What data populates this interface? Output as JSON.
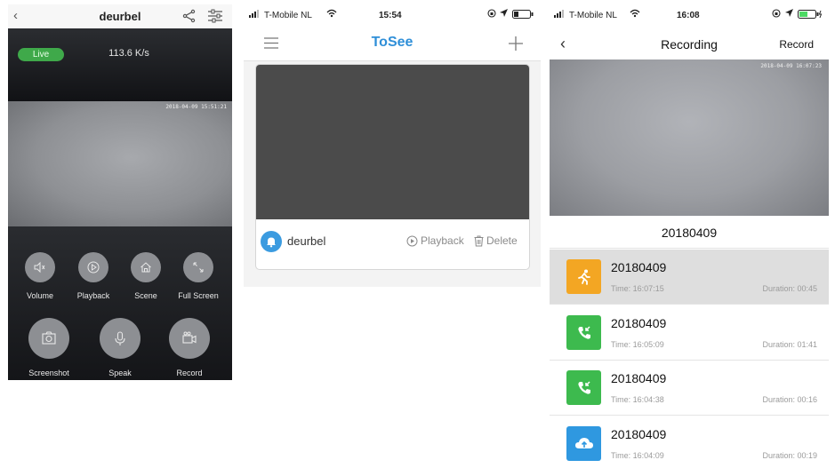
{
  "screen1": {
    "title": "deurbel",
    "live_label": "Live",
    "speed": "113.6 K/s",
    "video_timestamp": "2018-04-09 15:51:21",
    "controls": [
      {
        "label": "Volume",
        "icon": "speaker-icon"
      },
      {
        "label": "Playback",
        "icon": "play-icon"
      },
      {
        "label": "Scene",
        "icon": "home-icon"
      },
      {
        "label": "Full Screen",
        "icon": "expand-icon"
      },
      {
        "label": "Screenshot",
        "icon": "camera-icon"
      },
      {
        "label": "Speak",
        "icon": "microphone-icon"
      },
      {
        "label": "Record",
        "icon": "video-camera-icon"
      }
    ]
  },
  "screen2": {
    "carrier": "T-Mobile NL",
    "time": "15:54",
    "app_title": "ToSee",
    "device_name": "deurbel",
    "playback_label": "Playback",
    "delete_label": "Delete",
    "accent": "#2f8fd8"
  },
  "screen3": {
    "carrier": "T-Mobile NL",
    "time": "16:08",
    "title": "Recording",
    "record_label": "Record",
    "video_timestamp": "2018-04-09 16:07:23",
    "date": "20180409",
    "recordings": [
      {
        "name": "20180409",
        "time": "Time: 16:07:15",
        "duration": "Duration: 00:45",
        "type": "motion",
        "color": "#f3a623",
        "selected": true
      },
      {
        "name": "20180409",
        "time": "Time: 16:05:09",
        "duration": "Duration: 01:41",
        "type": "call",
        "color": "#3dba4e",
        "selected": false
      },
      {
        "name": "20180409",
        "time": "Time: 16:04:38",
        "duration": "Duration: 00:16",
        "type": "call",
        "color": "#3dba4e",
        "selected": false
      },
      {
        "name": "20180409",
        "time": "Time: 16:04:09",
        "duration": "Duration: 00:19",
        "type": "cloud",
        "color": "#2f98e0",
        "selected": false
      }
    ]
  }
}
